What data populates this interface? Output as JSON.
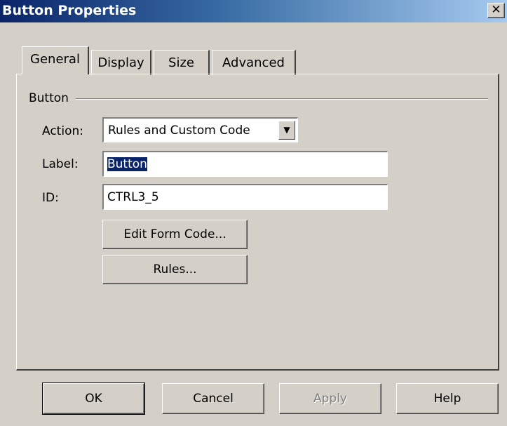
{
  "window": {
    "title": "Button Properties",
    "close_glyph": "✕"
  },
  "tabs": [
    {
      "label": "General",
      "active": true
    },
    {
      "label": "Display",
      "active": false
    },
    {
      "label": "Size",
      "active": false
    },
    {
      "label": "Advanced",
      "active": false
    }
  ],
  "group": {
    "label": "Button"
  },
  "fields": {
    "action": {
      "label": "Action:",
      "value": "Rules and Custom Code",
      "arrow": "▼"
    },
    "label": {
      "label": "Label:",
      "value": "Button"
    },
    "id": {
      "label": "ID:",
      "value": "CTRL3_5"
    }
  },
  "buttons": {
    "edit_form_code": "Edit Form Code...",
    "rules": "Rules...",
    "ok": "OK",
    "cancel": "Cancel",
    "apply": "Apply",
    "help": "Help"
  },
  "colors": {
    "titlebar_start": "#0a246a",
    "titlebar_end": "#a6caf0",
    "face": "#d4d0c8",
    "selection": "#0a246a"
  }
}
